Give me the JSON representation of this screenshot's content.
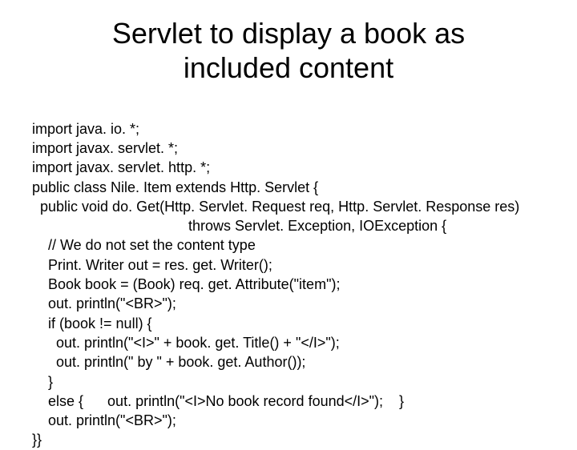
{
  "title": "Servlet to display a book as included content",
  "code": {
    "l1": "import java. io. *;",
    "l2": "import javax. servlet. *;",
    "l3": "import javax. servlet. http. *;",
    "l4": "public class Nile. Item extends Http. Servlet {",
    "l5": "  public void do. Get(Http. Servlet. Request req, Http. Servlet. Response res)",
    "l6": "                                       throws Servlet. Exception, IOException {",
    "l7": "    // We do not set the content type",
    "l8": "    Print. Writer out = res. get. Writer();",
    "l9": "    Book book = (Book) req. get. Attribute(\"item\");",
    "l10": "    out. println(\"<BR>\");",
    "l11": "    if (book != null) {",
    "l12": "      out. println(\"<I>\" + book. get. Title() + \"</I>\");",
    "l13": "      out. println(\" by \" + book. get. Author());",
    "l14": "    }",
    "l15": "    else {      out. println(\"<I>No book record found</I>\");    }",
    "l16": "    out. println(\"<BR>\");",
    "l17": "}}"
  }
}
